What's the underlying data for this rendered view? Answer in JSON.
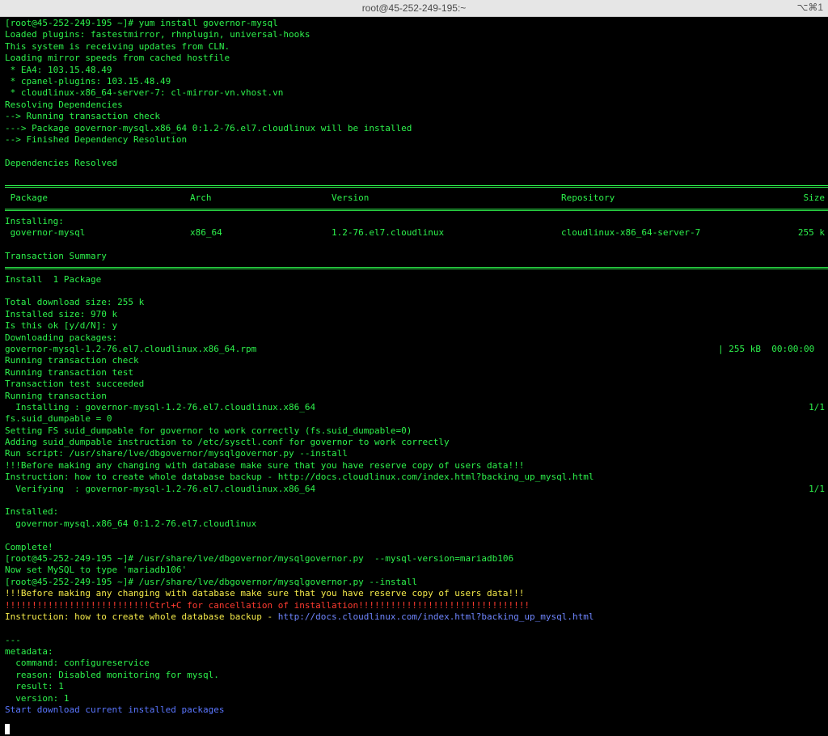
{
  "window": {
    "title": "root@45-252-249-195:~",
    "title_icon": "⌥⌘1"
  },
  "lines_a": [
    "[root@45-252-249-195 ~]# yum install governor-mysql",
    "Loaded plugins: fastestmirror, rhnplugin, universal-hooks",
    "This system is receiving updates from CLN.",
    "Loading mirror speeds from cached hostfile",
    " * EA4: 103.15.48.49",
    " * cpanel-plugins: 103.15.48.49",
    " * cloudlinux-x86_64-server-7: cl-mirror-vn.vhost.vn",
    "Resolving Dependencies",
    "--> Running transaction check",
    "---> Package governor-mysql.x86_64 0:1.2-76.el7.cloudlinux will be installed",
    "--> Finished Dependency Resolution",
    "",
    "Dependencies Resolved",
    ""
  ],
  "table": {
    "headers": {
      "package": " Package",
      "arch": "Arch",
      "version": "Version",
      "repository": "Repository",
      "size": "Size"
    },
    "installing_label": "Installing:",
    "row": {
      "package": " governor-mysql",
      "arch": "x86_64",
      "version": "1.2-76.el7.cloudlinux",
      "repository": "cloudlinux-x86_64-server-7",
      "size": "255 k"
    }
  },
  "transaction_summary": "Transaction Summary",
  "lines_b": [
    "Install  1 Package",
    "",
    "Total download size: 255 k",
    "Installed size: 970 k",
    "Is this ok [y/d/N]: y",
    "Downloading packages:"
  ],
  "download": {
    "file": "governor-mysql-1.2-76.el7.cloudlinux.x86_64.rpm",
    "progress": "| 255 kB  00:00:00"
  },
  "lines_c": [
    "Running transaction check",
    "Running transaction test",
    "Transaction test succeeded",
    "Running transaction"
  ],
  "installing_step": {
    "text": "  Installing : governor-mysql-1.2-76.el7.cloudlinux.x86_64",
    "count": "1/1"
  },
  "lines_d": [
    "fs.suid_dumpable = 0",
    "Setting FS suid_dumpable for governor to work correctly (fs.suid_dumpable=0)",
    "Adding suid_dumpable instruction to /etc/sysctl.conf for governor to work correctly",
    "Run script: /usr/share/lve/dbgovernor/mysqlgovernor.py --install",
    "!!!Before making any changing with database make sure that you have reserve copy of users data!!!",
    "Instruction: how to create whole database backup - http://docs.cloudlinux.com/index.html?backing_up_mysql.html"
  ],
  "verifying_step": {
    "text": "  Verifying  : governor-mysql-1.2-76.el7.cloudlinux.x86_64",
    "count": "1/1"
  },
  "lines_e": [
    "",
    "Installed:",
    "  governor-mysql.x86_64 0:1.2-76.el7.cloudlinux",
    "",
    "Complete!",
    "[root@45-252-249-195 ~]# /usr/share/lve/dbgovernor/mysqlgovernor.py  --mysql-version=mariadb106",
    "Now set MySQL to type 'mariadb106'",
    "[root@45-252-249-195 ~]# /usr/share/lve/dbgovernor/mysqlgovernor.py --install"
  ],
  "warning_yellow": "!!!Before making any changing with database make sure that you have reserve copy of users data!!!",
  "warning_red": "!!!!!!!!!!!!!!!!!!!!!!!!!!!Ctrl+C for cancellation of installation!!!!!!!!!!!!!!!!!!!!!!!!!!!!!!!!",
  "instruction": {
    "prefix": "Instruction: how to create whole database backup - ",
    "url": "http://docs.cloudlinux.com/index.html?backing_up_mysql.html"
  },
  "lines_f": [
    "",
    "---",
    "metadata:",
    "  command: configureservice",
    "  reason: Disabled monitoring for mysql.",
    "  result: 1",
    "  version: 1"
  ],
  "status_blue": "Start download current installed packages"
}
